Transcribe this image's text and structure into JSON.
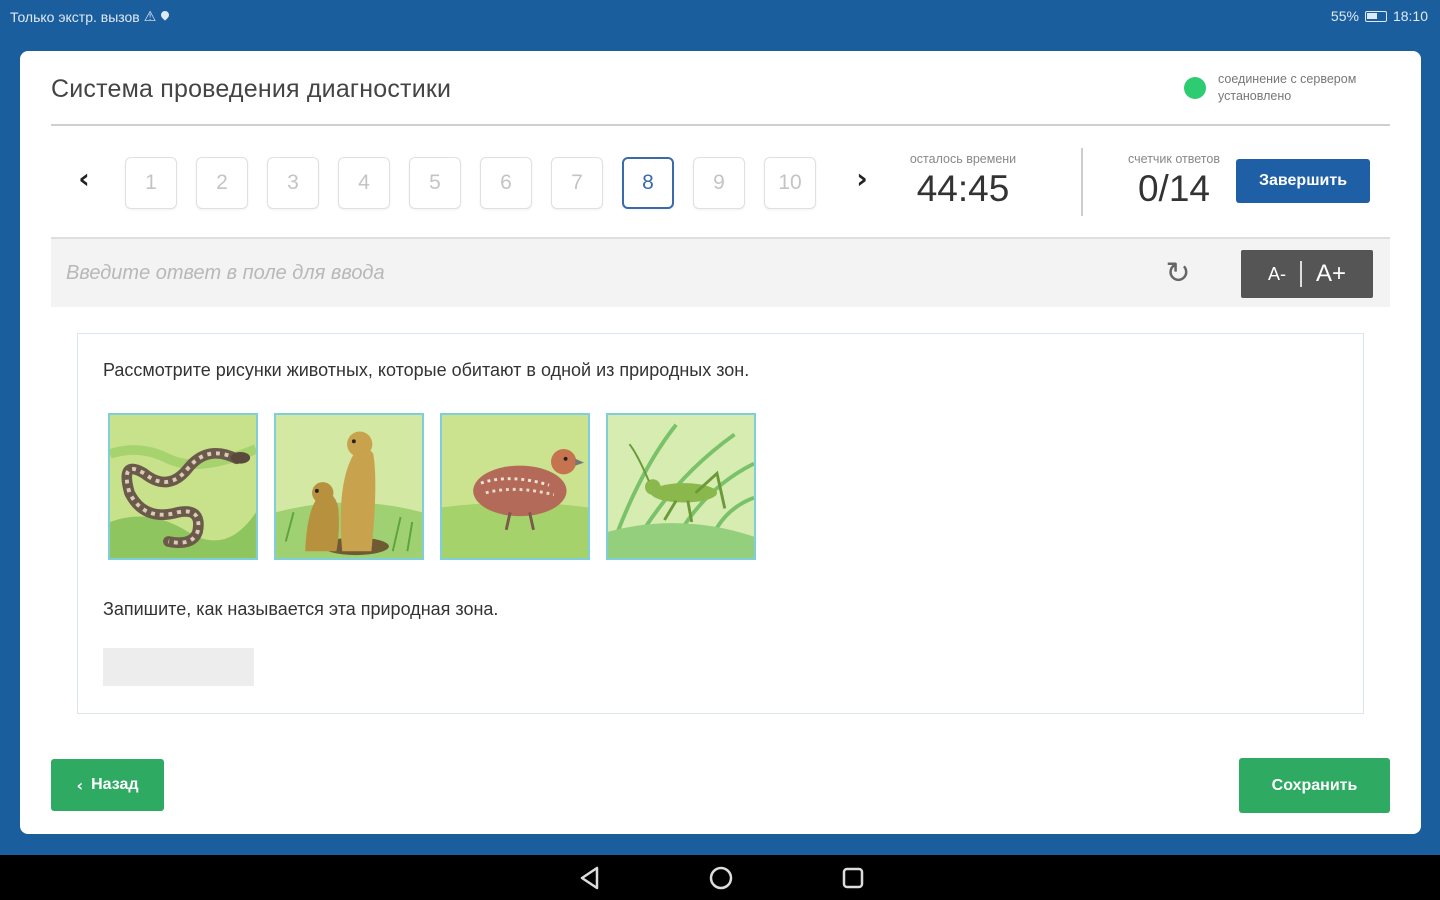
{
  "statusbar": {
    "left_text": "Только экстр. вызов",
    "warning_glyph": "⚠",
    "right_text": "55%",
    "time": "18:10"
  },
  "header": {
    "title": "Система проведения диагностики",
    "connection_status": "соединение с сервером установлено",
    "connection_color": "#2ecc71"
  },
  "nav": {
    "prev_glyph": "‹",
    "next_glyph": "›",
    "questions": [
      "1",
      "2",
      "3",
      "4",
      "5",
      "6",
      "7",
      "8",
      "9",
      "10"
    ],
    "active_question": "8"
  },
  "timer": {
    "label": "осталось времени",
    "value": "44:45"
  },
  "counter": {
    "label": "счетчик ответов",
    "value": "0/14"
  },
  "finish_label": "Завершить",
  "answer": {
    "placeholder": "Введите ответ в поле для ввода",
    "refresh_glyph": "↻",
    "font_minus": "A-",
    "font_plus": "A+"
  },
  "question": {
    "prompt": "Рассмотрите рисунки животных, которые обитают в одной из природных зон.",
    "instruction": "Запишите, как называется эта природная зона.",
    "images": [
      "snake",
      "gophers",
      "partridge",
      "grasshopper"
    ]
  },
  "buttons": {
    "back_label": "Назад",
    "back_glyph": "‹",
    "save_label": "Сохранить"
  },
  "colors": {
    "brand_blue": "#1f5fa5",
    "background_blue": "#1b5e9e",
    "accent_green": "#2eaa63"
  }
}
